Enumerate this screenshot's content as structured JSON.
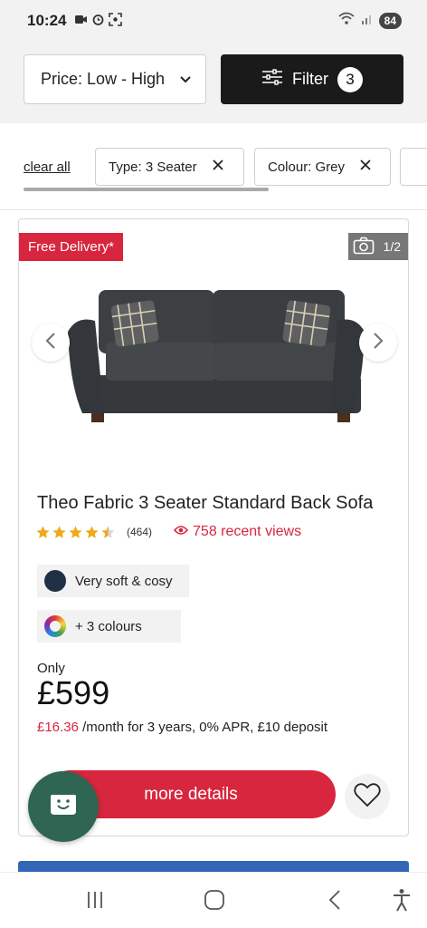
{
  "status_bar": {
    "time": "10:24",
    "battery": "84"
  },
  "sort": {
    "label": "Price: Low - High"
  },
  "filter": {
    "label": "Filter",
    "count": "3"
  },
  "chips": {
    "clear_all": "clear all",
    "type": "Type: 3 Seater",
    "colour": "Colour: Grey"
  },
  "product": {
    "badge": "Free Delivery*",
    "photo_counter": "1/2",
    "title": "Theo Fabric 3 Seater Standard Back Sofa",
    "rating": 4.5,
    "review_count": "(464)",
    "recent_views": "758 recent views",
    "features": {
      "soft": "Very soft & cosy",
      "colours": "+ 3 colours"
    },
    "price_prefix": "Only",
    "price": "£599",
    "finance_amount": "£16.36",
    "finance_text": "/month for 3 years, 0% APR, £10 deposit",
    "cta": "more details"
  },
  "colors": {
    "accent_red": "#d7263d",
    "dark": "#1a1a1a",
    "chat_green": "#2f6553",
    "star_gold": "#f0a81c"
  }
}
